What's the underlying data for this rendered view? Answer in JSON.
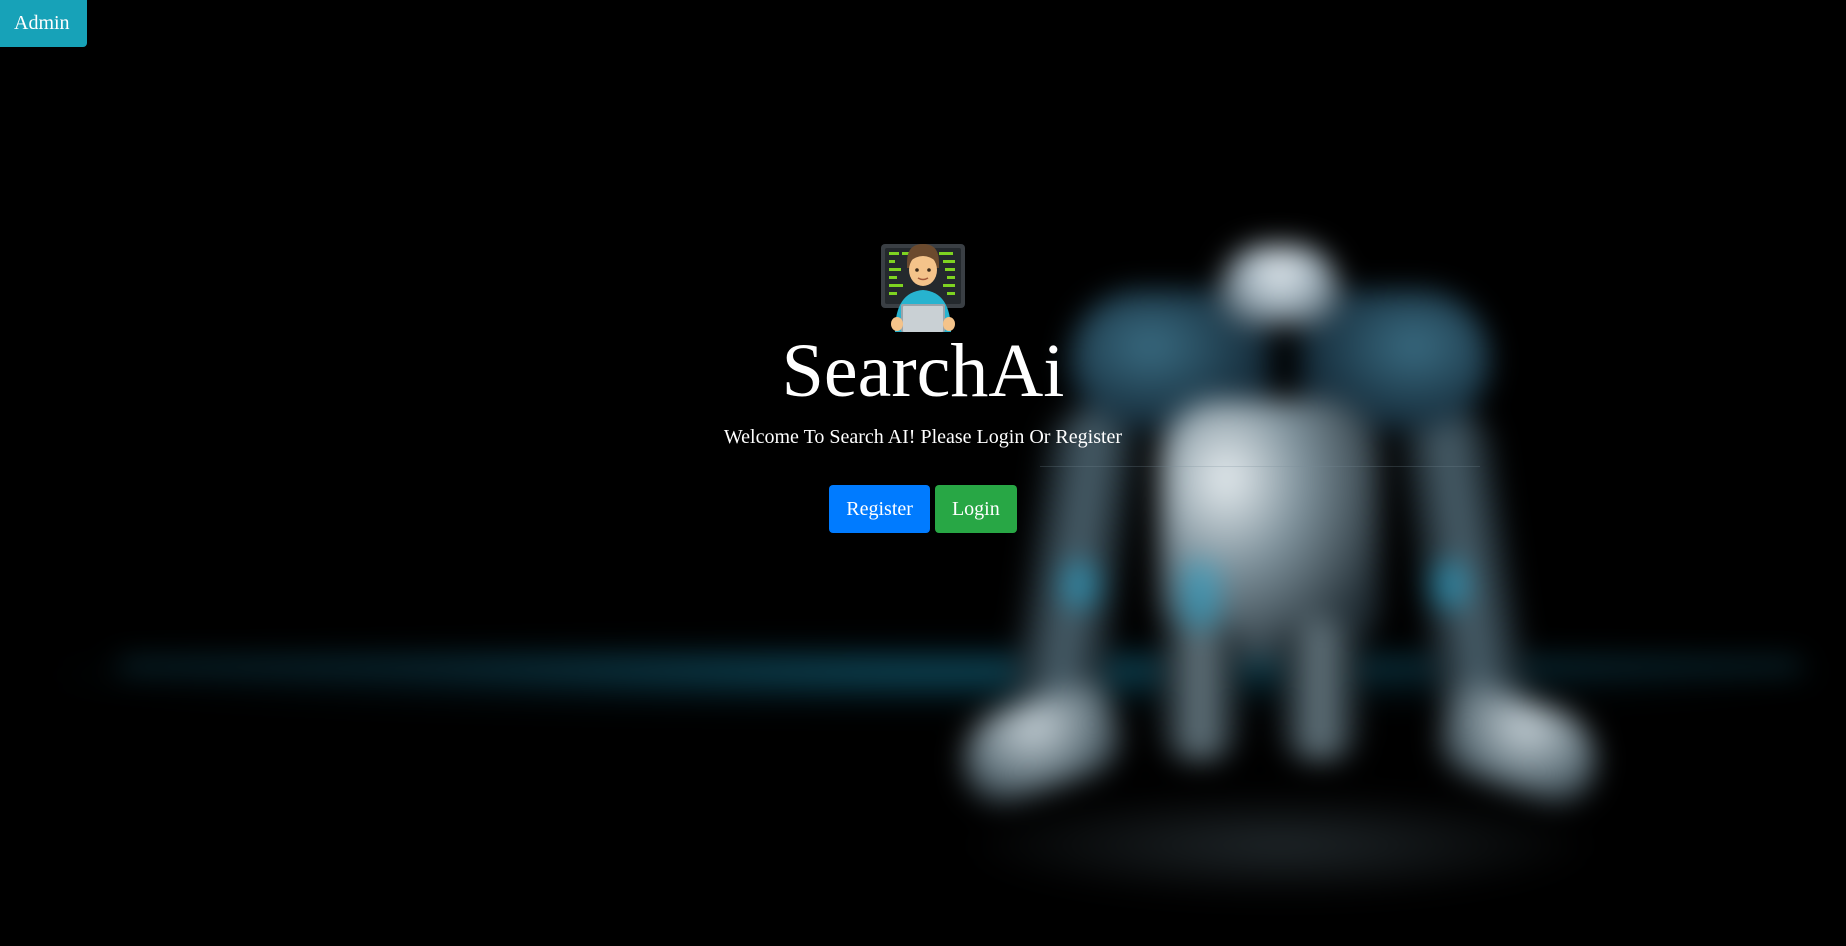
{
  "header": {
    "admin_label": "Admin"
  },
  "hero": {
    "icon": "technologist-icon",
    "title": "SearchAi",
    "subtitle": "Welcome To Search AI! Please Login Or Register"
  },
  "actions": {
    "register_label": "Register",
    "login_label": "Login"
  },
  "colors": {
    "admin": "#17a2b8",
    "register": "#007bff",
    "login": "#28a745",
    "background": "#000000"
  }
}
